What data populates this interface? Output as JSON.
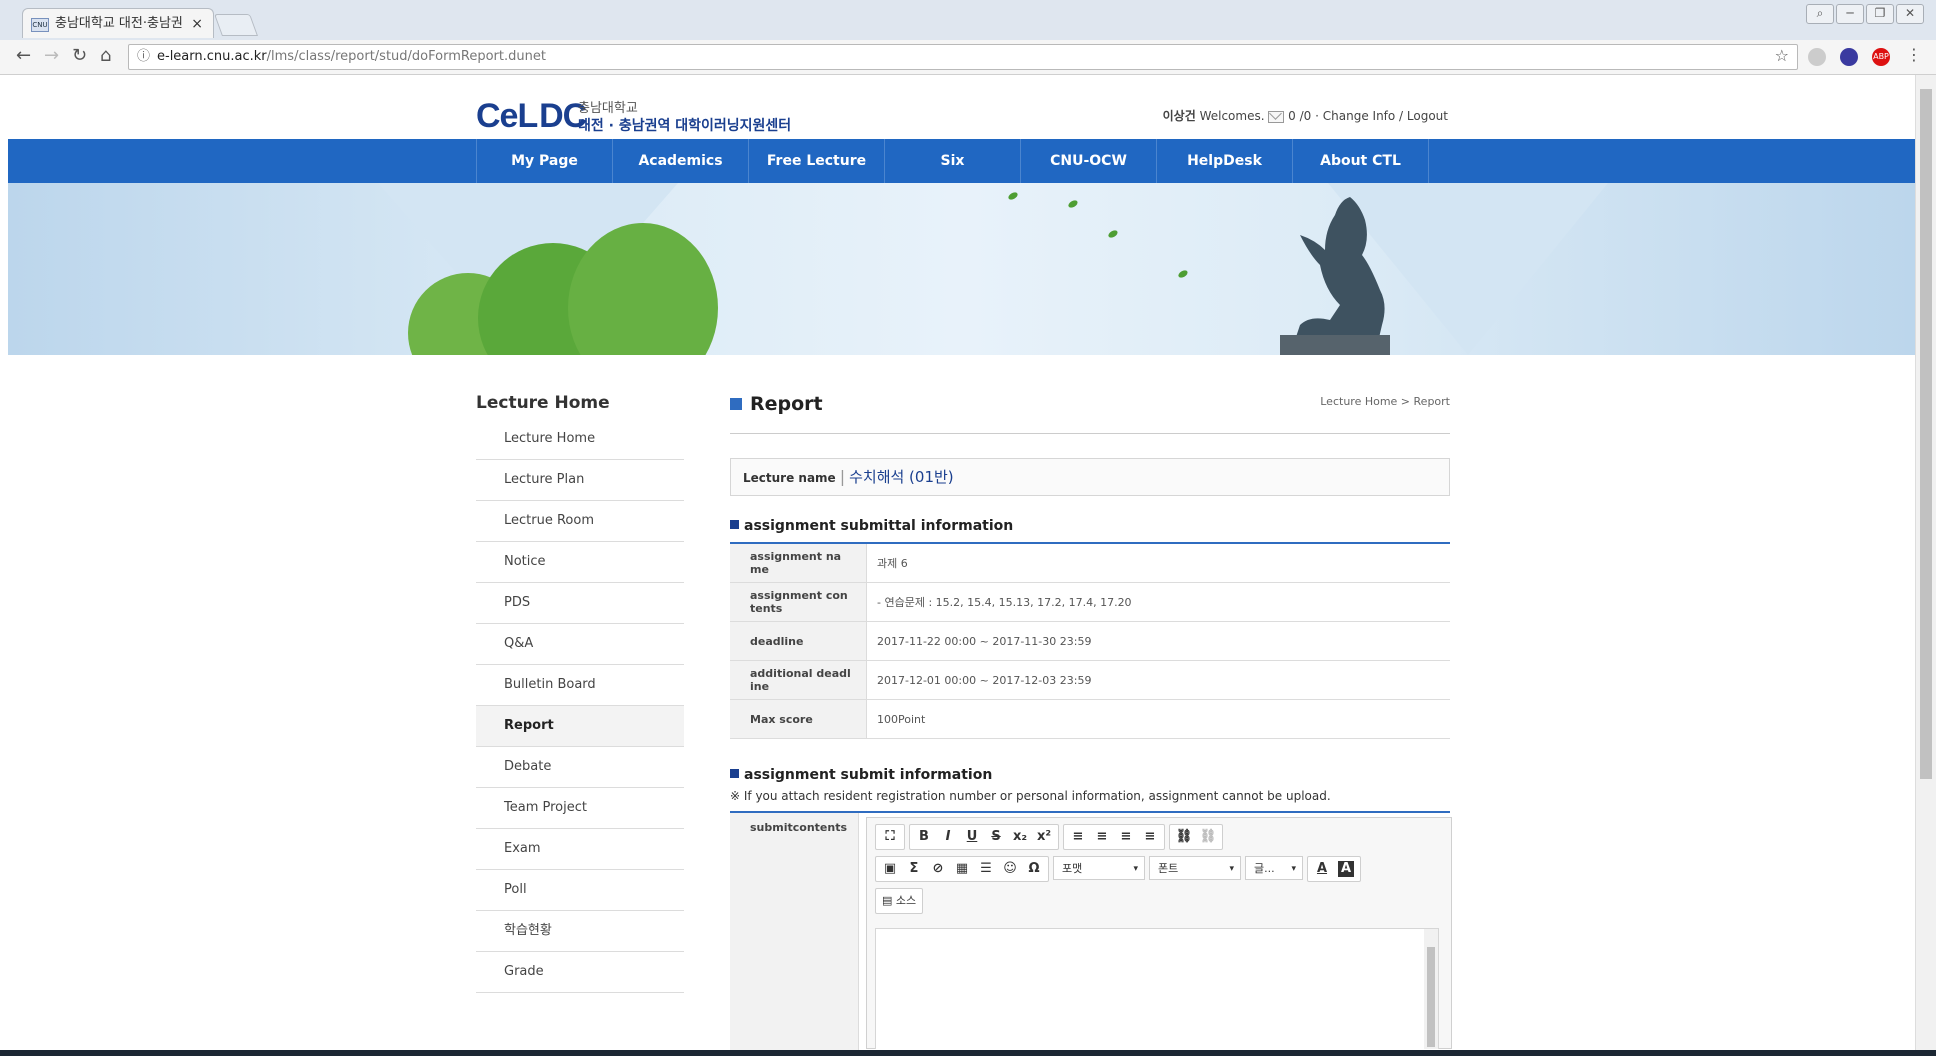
{
  "browser": {
    "tab_title": "충남대학교 대전·충남권",
    "tab_favicon": "CNU",
    "tab_close": "×",
    "url_host": "e-learn.cnu.ac.kr",
    "url_path": "/lms/class/report/stud/doFormReport.dunet",
    "ext_abp": "ABP",
    "window_controls": [
      "⌕",
      "─",
      "❐",
      "✕"
    ]
  },
  "header": {
    "logo_main_1": "CeL",
    "logo_main_2": "DC",
    "logo_sub1": "충남대학교",
    "logo_sub2": "대전 · 충남권역 대학이러닝지원센터",
    "user_name": "이상건",
    "welcome": " Welcomes. ",
    "mail_count": " 0 /0",
    "sep1": " · ",
    "change_info": "Change Info",
    "sep2": " / ",
    "logout": "Logout"
  },
  "gnb": [
    "My Page",
    "Academics",
    "Free Lecture",
    "Six competencies",
    "CNU-OCW",
    "HelpDesk",
    "About CTL"
  ],
  "sidebar": {
    "title": "Lecture Home",
    "items": [
      "Lecture Home",
      "Lecture Plan",
      "Lectrue Room",
      "Notice",
      "PDS",
      "Q&A",
      "Bulletin Board",
      "Report",
      "Debate",
      "Team Project",
      "Exam",
      "Poll",
      "학습현황",
      "Grade"
    ]
  },
  "content": {
    "title": "Report",
    "breadcrumb": "Lecture Home > Report",
    "lecture_label": "Lecture name",
    "lecture_sep": "|",
    "lecture_name": "수치해석 (01반)",
    "section1_title": "assignment submittal information",
    "info": [
      {
        "label": "assignment na me",
        "value": "과제 6"
      },
      {
        "label": "assignment con tents",
        "value": "- 연습문제 : 15.2, 15.4, 15.13, 17.2, 17.4, 17.20"
      },
      {
        "label": "deadline",
        "value": "2017-11-22 00:00 ~ 2017-11-30 23:59"
      },
      {
        "label": "additional deadl ine",
        "value": "2017-12-01 00:00 ~ 2017-12-03 23:59"
      },
      {
        "label": "Max score",
        "value": "100Point"
      }
    ],
    "section2_title": "assignment submit information",
    "notice": "※ If you attach resident registration number or personal information, assignment cannot be upload.",
    "submit_label": "submitcontents"
  },
  "editor": {
    "row1": [
      "⛶",
      "B",
      "I",
      "U",
      "S",
      "x₂",
      "x²",
      "≡",
      "≡",
      "≡",
      "≡",
      "⛓",
      "⛓"
    ],
    "row2_icons": [
      "▣",
      "Σ",
      "⊘",
      "▦",
      "☰",
      "☺",
      "Ω"
    ],
    "format_label": "포맷",
    "font_label": "폰트",
    "size_label": "글...",
    "combo_arrow": "▾",
    "text_color": "A",
    "bg_color": "A",
    "source_label": "소스"
  },
  "colors": {
    "gnb": "#2067c2",
    "accent": "#2f6cc0",
    "logo": "#1a3f8f"
  }
}
